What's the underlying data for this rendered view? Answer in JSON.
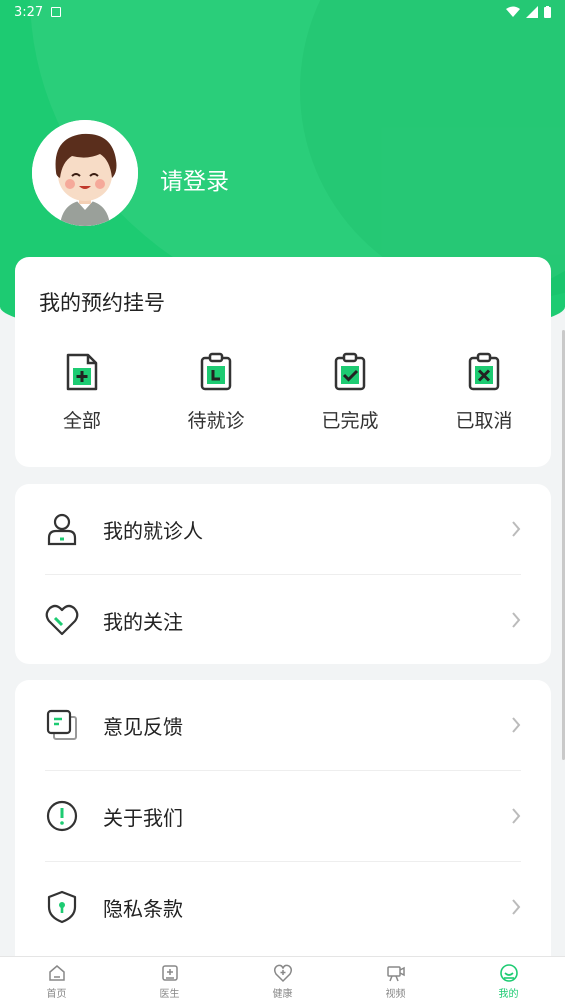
{
  "status_bar": {
    "time": "3:27"
  },
  "profile": {
    "login_text": "请登录"
  },
  "appointments": {
    "title": "我的预约挂号",
    "items": [
      {
        "label": "全部",
        "icon": "document-plus-icon"
      },
      {
        "label": "待就诊",
        "icon": "clipboard-pending-icon"
      },
      {
        "label": "已完成",
        "icon": "clipboard-check-icon"
      },
      {
        "label": "已取消",
        "icon": "clipboard-cancel-icon"
      }
    ]
  },
  "menu_group_1": [
    {
      "label": "我的就诊人",
      "icon": "patient-icon"
    },
    {
      "label": "我的关注",
      "icon": "heart-icon"
    }
  ],
  "menu_group_2": [
    {
      "label": "意见反馈",
      "icon": "feedback-icon"
    },
    {
      "label": "关于我们",
      "icon": "info-icon"
    },
    {
      "label": "隐私条款",
      "icon": "shield-icon"
    }
  ],
  "tabs": [
    {
      "label": "首页",
      "icon": "home-icon"
    },
    {
      "label": "医生",
      "icon": "doctor-icon"
    },
    {
      "label": "健康",
      "icon": "health-icon"
    },
    {
      "label": "视频",
      "icon": "video-icon"
    },
    {
      "label": "我的",
      "icon": "profile-icon",
      "active": true
    }
  ],
  "colors": {
    "accent": "#1dcb72",
    "background": "#f2f4f5"
  }
}
